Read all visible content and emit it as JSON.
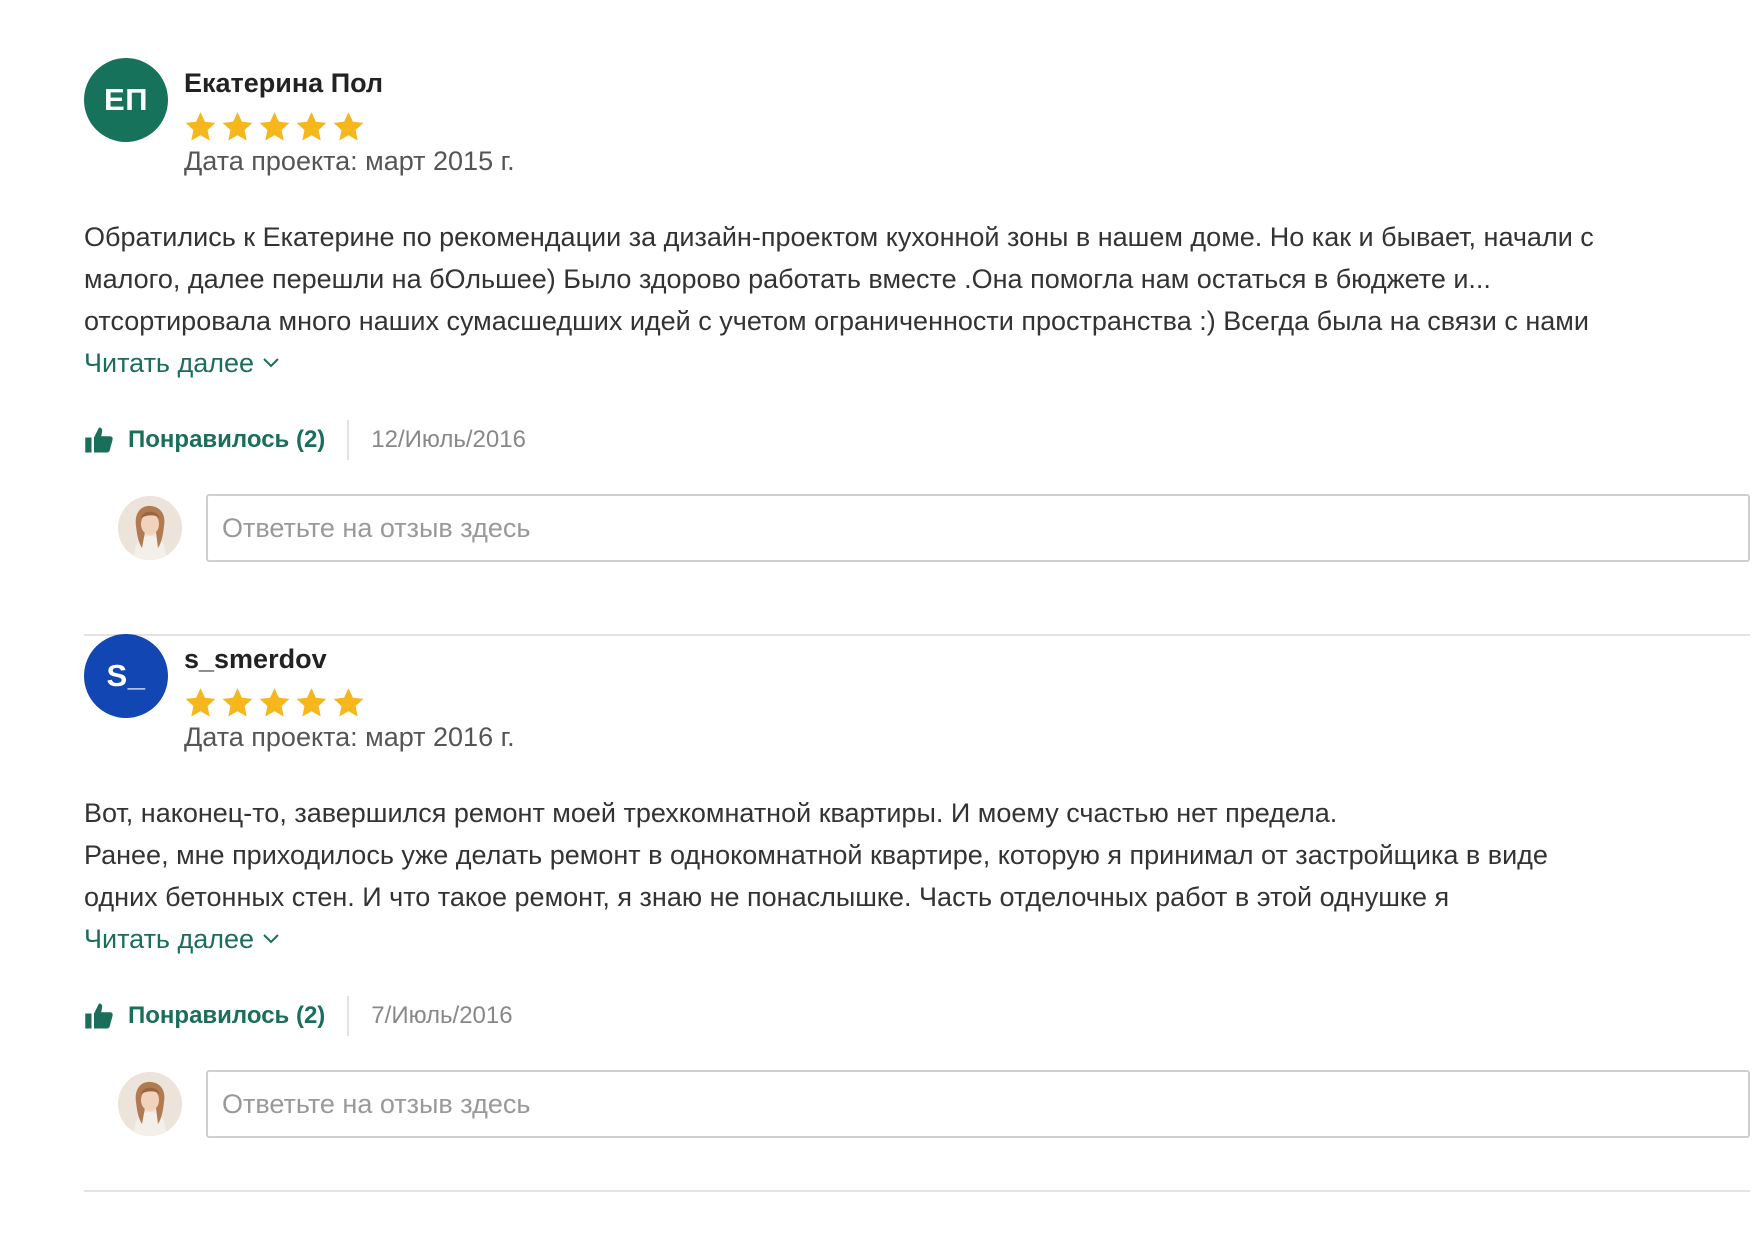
{
  "colors": {
    "accent_green": "#1b6e5a",
    "star_yellow": "#f6b71d",
    "divider": "#e3e3e3"
  },
  "reviews": [
    {
      "avatar_initials": "ЕП",
      "avatar_color": "#17725c",
      "author": "Екатерина Пол",
      "rating": 5,
      "project_date": "Дата проекта: март 2015 г.",
      "body_lines": [
        "Обратились к Екатерине по рекомендации за дизайн-проектом кухонной зоны в нашем доме. Но как и бывает, начали с",
        "малого, далее перешли на бОльшее) Было здорово работать вместе .Она помогла нам остаться в бюджете и...",
        "отсортировала много наших сумасшедших идей с учетом ограниченности пространства :) Всегда была на связи с нами"
      ],
      "read_more": "Читать далее",
      "like_label": "Понравилось (2)",
      "date": "12/Июль/2016",
      "reply_placeholder": "Ответьте на отзыв здесь"
    },
    {
      "avatar_initials": "S_",
      "avatar_color": "#1247b3",
      "author": "s_smerdov",
      "rating": 5,
      "project_date": "Дата проекта: март 2016 г.",
      "body_lines": [
        "Вот, наконец-то, завершился ремонт моей трехкомнатной квартиры. И моему счастью нет предела.",
        "Ранее, мне приходилось уже делать ремонт в однокомнатной квартире, которую я принимал от застройщика в виде",
        "одних бетонных стен. И что такое ремонт, я знаю не понаслышке. Часть отделочных работ в этой однушке я"
      ],
      "read_more": "Читать далее",
      "like_label": "Понравилось (2)",
      "date": "7/Июль/2016",
      "reply_placeholder": "Ответьте на отзыв здесь"
    }
  ]
}
